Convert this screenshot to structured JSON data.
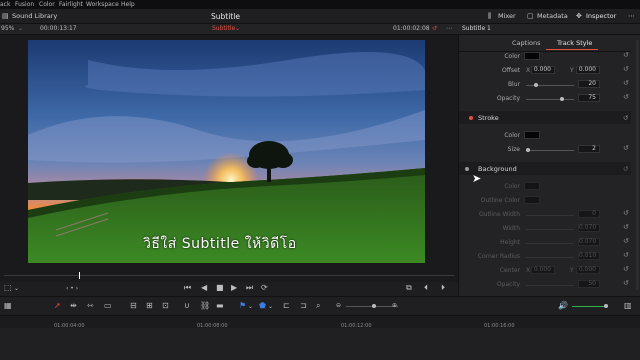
{
  "menu": [
    "ack",
    "Fusion",
    "Color",
    "Fairlight",
    "Workspace",
    "Help"
  ],
  "header": {
    "sound_library": "Sound Library",
    "title": "Subtitle",
    "mixer": "Mixer",
    "metadata": "Metadata",
    "inspector": "Inspector"
  },
  "viewer_bar": {
    "zoom": "95%",
    "timecode_left": "00:00:13:17",
    "clip_name": "Subtitle",
    "timecode_right": "01:00:02:08",
    "panel_title": "Subtitle 1"
  },
  "subtitle_text": "วิธีใส่ Subtitle ให้วิดีโอ",
  "inspector": {
    "tabs": [
      "Captions",
      "Track Style"
    ],
    "color_label": "Color",
    "offset": {
      "label": "Offset",
      "x_label": "X",
      "x": "0.000",
      "y_label": "Y",
      "y": "0.000"
    },
    "blur": {
      "label": "Blur",
      "value": "20",
      "level": 0.2
    },
    "opacity": {
      "label": "Opacity",
      "value": "75",
      "level": 0.75
    },
    "stroke": {
      "title": "Stroke",
      "color_label": "Color",
      "size_label": "Size",
      "size_value": "2",
      "size_level": 0.05
    },
    "background": {
      "title": "Background",
      "color_label": "Color",
      "outline_color_label": "Outline Color",
      "outline_width_label": "Outline Width",
      "outline_width_value": "0",
      "width_label": "Width",
      "width_value": "0.070",
      "height_label": "Height",
      "height_value": "0.070",
      "corner_radius_label": "Corner Radius",
      "corner_radius_value": "0.010",
      "center_label": "Center",
      "center_x_label": "X",
      "center_x": "0.000",
      "center_y_label": "Y",
      "center_y": "0.000",
      "opacity_label": "Opacity",
      "opacity_value": "50"
    }
  },
  "timeline": {
    "ruler": [
      "01:00:04:00",
      "01:00:08:00",
      "01:00:12:00",
      "01:00:16:00"
    ]
  },
  "colors": {
    "accent_red": "#e0523e",
    "playhead": "#e34b3c",
    "stroke_dot": "#e0523e",
    "volume_green": "#2bb34a"
  }
}
